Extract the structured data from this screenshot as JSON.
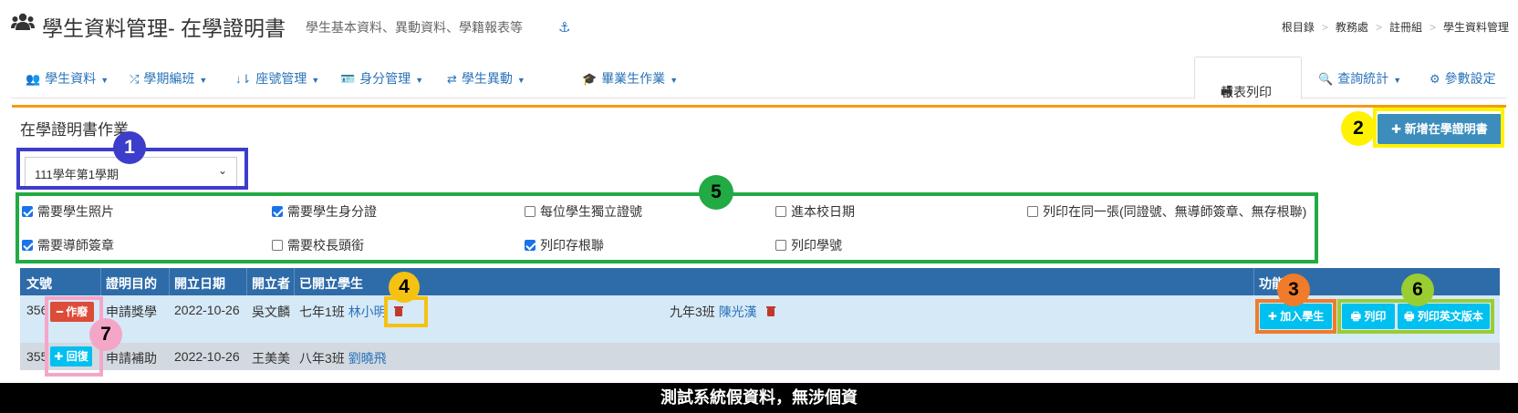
{
  "header": {
    "title": "學生資料管理- 在學證明書",
    "subtitle": "學生基本資料、異動資料、學籍報表等",
    "anchor_icon": "anchor-icon",
    "breadcrumb": [
      "根目錄",
      "教務處",
      "註冊組",
      "學生資料管理"
    ]
  },
  "nav": {
    "items": [
      {
        "label": "學生資料",
        "icon": "users-icon"
      },
      {
        "label": "學期編班",
        "icon": "shuffle-icon"
      },
      {
        "label": "座號管理",
        "icon": "sort-icon"
      },
      {
        "label": "身分管理",
        "icon": "id-card-icon"
      },
      {
        "label": "學生異動",
        "icon": "exchange-icon"
      },
      {
        "label": "畢業生作業",
        "icon": "graduation-cap-icon"
      }
    ],
    "right": [
      {
        "label": "報表列印",
        "icon": "print-icon"
      },
      {
        "label": "查詢統計",
        "icon": "search-icon"
      },
      {
        "label": "參數設定",
        "icon": "gear-icon"
      }
    ]
  },
  "panel": {
    "title": "在學證明書作業",
    "add_button": "新增在學證明書",
    "semester": "111學年第1學期"
  },
  "options": [
    {
      "label": "需要學生照片",
      "checked": true
    },
    {
      "label": "需要學生身分證",
      "checked": true
    },
    {
      "label": "每位學生獨立證號",
      "checked": false
    },
    {
      "label": "進本校日期",
      "checked": false
    },
    {
      "label": "列印在同一張(同證號、無導師簽章、無存根聯)",
      "checked": false
    },
    {
      "label": "需要導師簽章",
      "checked": true
    },
    {
      "label": "需要校長頭銜",
      "checked": false
    },
    {
      "label": "列印存根聯",
      "checked": true
    },
    {
      "label": "列印學號",
      "checked": false
    }
  ],
  "table": {
    "headers": [
      "文號",
      "證明目的",
      "開立日期",
      "開立者",
      "已開立學生",
      "功能"
    ],
    "rows": [
      {
        "no": "356",
        "action": "作廢",
        "purpose": "申請獎學",
        "date": "2022-10-26",
        "issuer": "吳文麟",
        "students": [
          {
            "cls": "七年1班",
            "name": "林小明"
          },
          {
            "cls": "九年3班",
            "name": "陳光漢"
          }
        ],
        "buttons": [
          "加入學生",
          "列印",
          "列印英文版本"
        ]
      },
      {
        "no": "355",
        "action": "回復",
        "purpose": "申請補助",
        "date": "2022-10-26",
        "issuer": "王美美",
        "students": [
          {
            "cls": "八年3班",
            "name": "劉曉飛"
          }
        ]
      }
    ]
  },
  "markers": [
    "1",
    "2",
    "3",
    "4",
    "5",
    "6",
    "7"
  ],
  "footer": "測試系統假資料，無涉個資",
  "colors": {
    "accent": "#3c8dbc",
    "panel_top": "#f39c12",
    "table_head": "#2e6ba9",
    "danger": "#dd4b39",
    "info": "#00c0ef"
  }
}
